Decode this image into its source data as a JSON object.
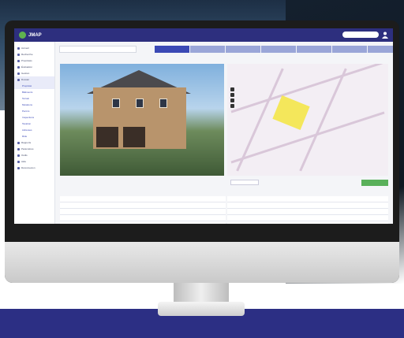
{
  "app": {
    "brand": "JMAP"
  },
  "topbar": {
    "search_placeholder": ""
  },
  "sidebar": {
    "items": [
      {
        "label": "Accueil",
        "active": false,
        "sub": false
      },
      {
        "label": "Recherche",
        "active": false,
        "sub": false
      },
      {
        "label": "Propriétés",
        "active": false,
        "sub": false
      },
      {
        "label": "Évaluation",
        "active": false,
        "sub": false
      },
      {
        "label": "Gestion",
        "active": false,
        "sub": false
      },
      {
        "label": "Dossier",
        "active": true,
        "sub": false
      },
      {
        "label": "Propriété",
        "active": true,
        "sub": true
      },
      {
        "label": "Bâtiments",
        "active": false,
        "sub": true
      },
      {
        "label": "Terrain",
        "active": false,
        "sub": true
      },
      {
        "label": "Mutations",
        "active": false,
        "sub": true
      },
      {
        "label": "Permis",
        "active": false,
        "sub": true
      },
      {
        "label": "Inspections",
        "active": false,
        "sub": true
      },
      {
        "label": "Taxation",
        "active": false,
        "sub": true
      },
      {
        "label": "Adresses",
        "active": false,
        "sub": true
      },
      {
        "label": "Rôle",
        "active": false,
        "sub": true
      },
      {
        "label": "Rapports",
        "active": false,
        "sub": false
      },
      {
        "label": "Paramètres",
        "active": false,
        "sub": false
      },
      {
        "label": "Outils",
        "active": false,
        "sub": false
      },
      {
        "label": "Aide",
        "active": false,
        "sub": false
      },
      {
        "label": "Déconnexion",
        "active": false,
        "sub": false
      }
    ]
  },
  "main": {
    "address_selector": "",
    "tabs": [
      {
        "label": "",
        "active": true
      },
      {
        "label": "",
        "active": false
      },
      {
        "label": "",
        "active": false
      },
      {
        "label": "",
        "active": false
      },
      {
        "label": "",
        "active": false
      },
      {
        "label": "",
        "active": false
      },
      {
        "label": "",
        "active": false
      }
    ],
    "back_label": "",
    "summary": "",
    "map_control_label": "",
    "map_select_value": "",
    "map_button": "",
    "left_rows": [
      {
        "label": "",
        "value": ""
      },
      {
        "label": "",
        "value": ""
      },
      {
        "label": "",
        "value": ""
      },
      {
        "label": "",
        "value": ""
      },
      {
        "label": "",
        "value": ""
      },
      {
        "label": "",
        "value": ""
      }
    ],
    "right_rows": [
      {
        "label": "",
        "value": ""
      },
      {
        "label": "",
        "value": ""
      },
      {
        "label": "",
        "value": ""
      },
      {
        "label": "",
        "value": ""
      },
      {
        "label": "",
        "value": ""
      },
      {
        "label": "",
        "value": ""
      }
    ]
  },
  "colors": {
    "topbar": "#2d2f7e",
    "accent": "#3b49b5",
    "parcel": "#f4e64a",
    "action": "#59b05a",
    "band": "#2c2f84"
  }
}
